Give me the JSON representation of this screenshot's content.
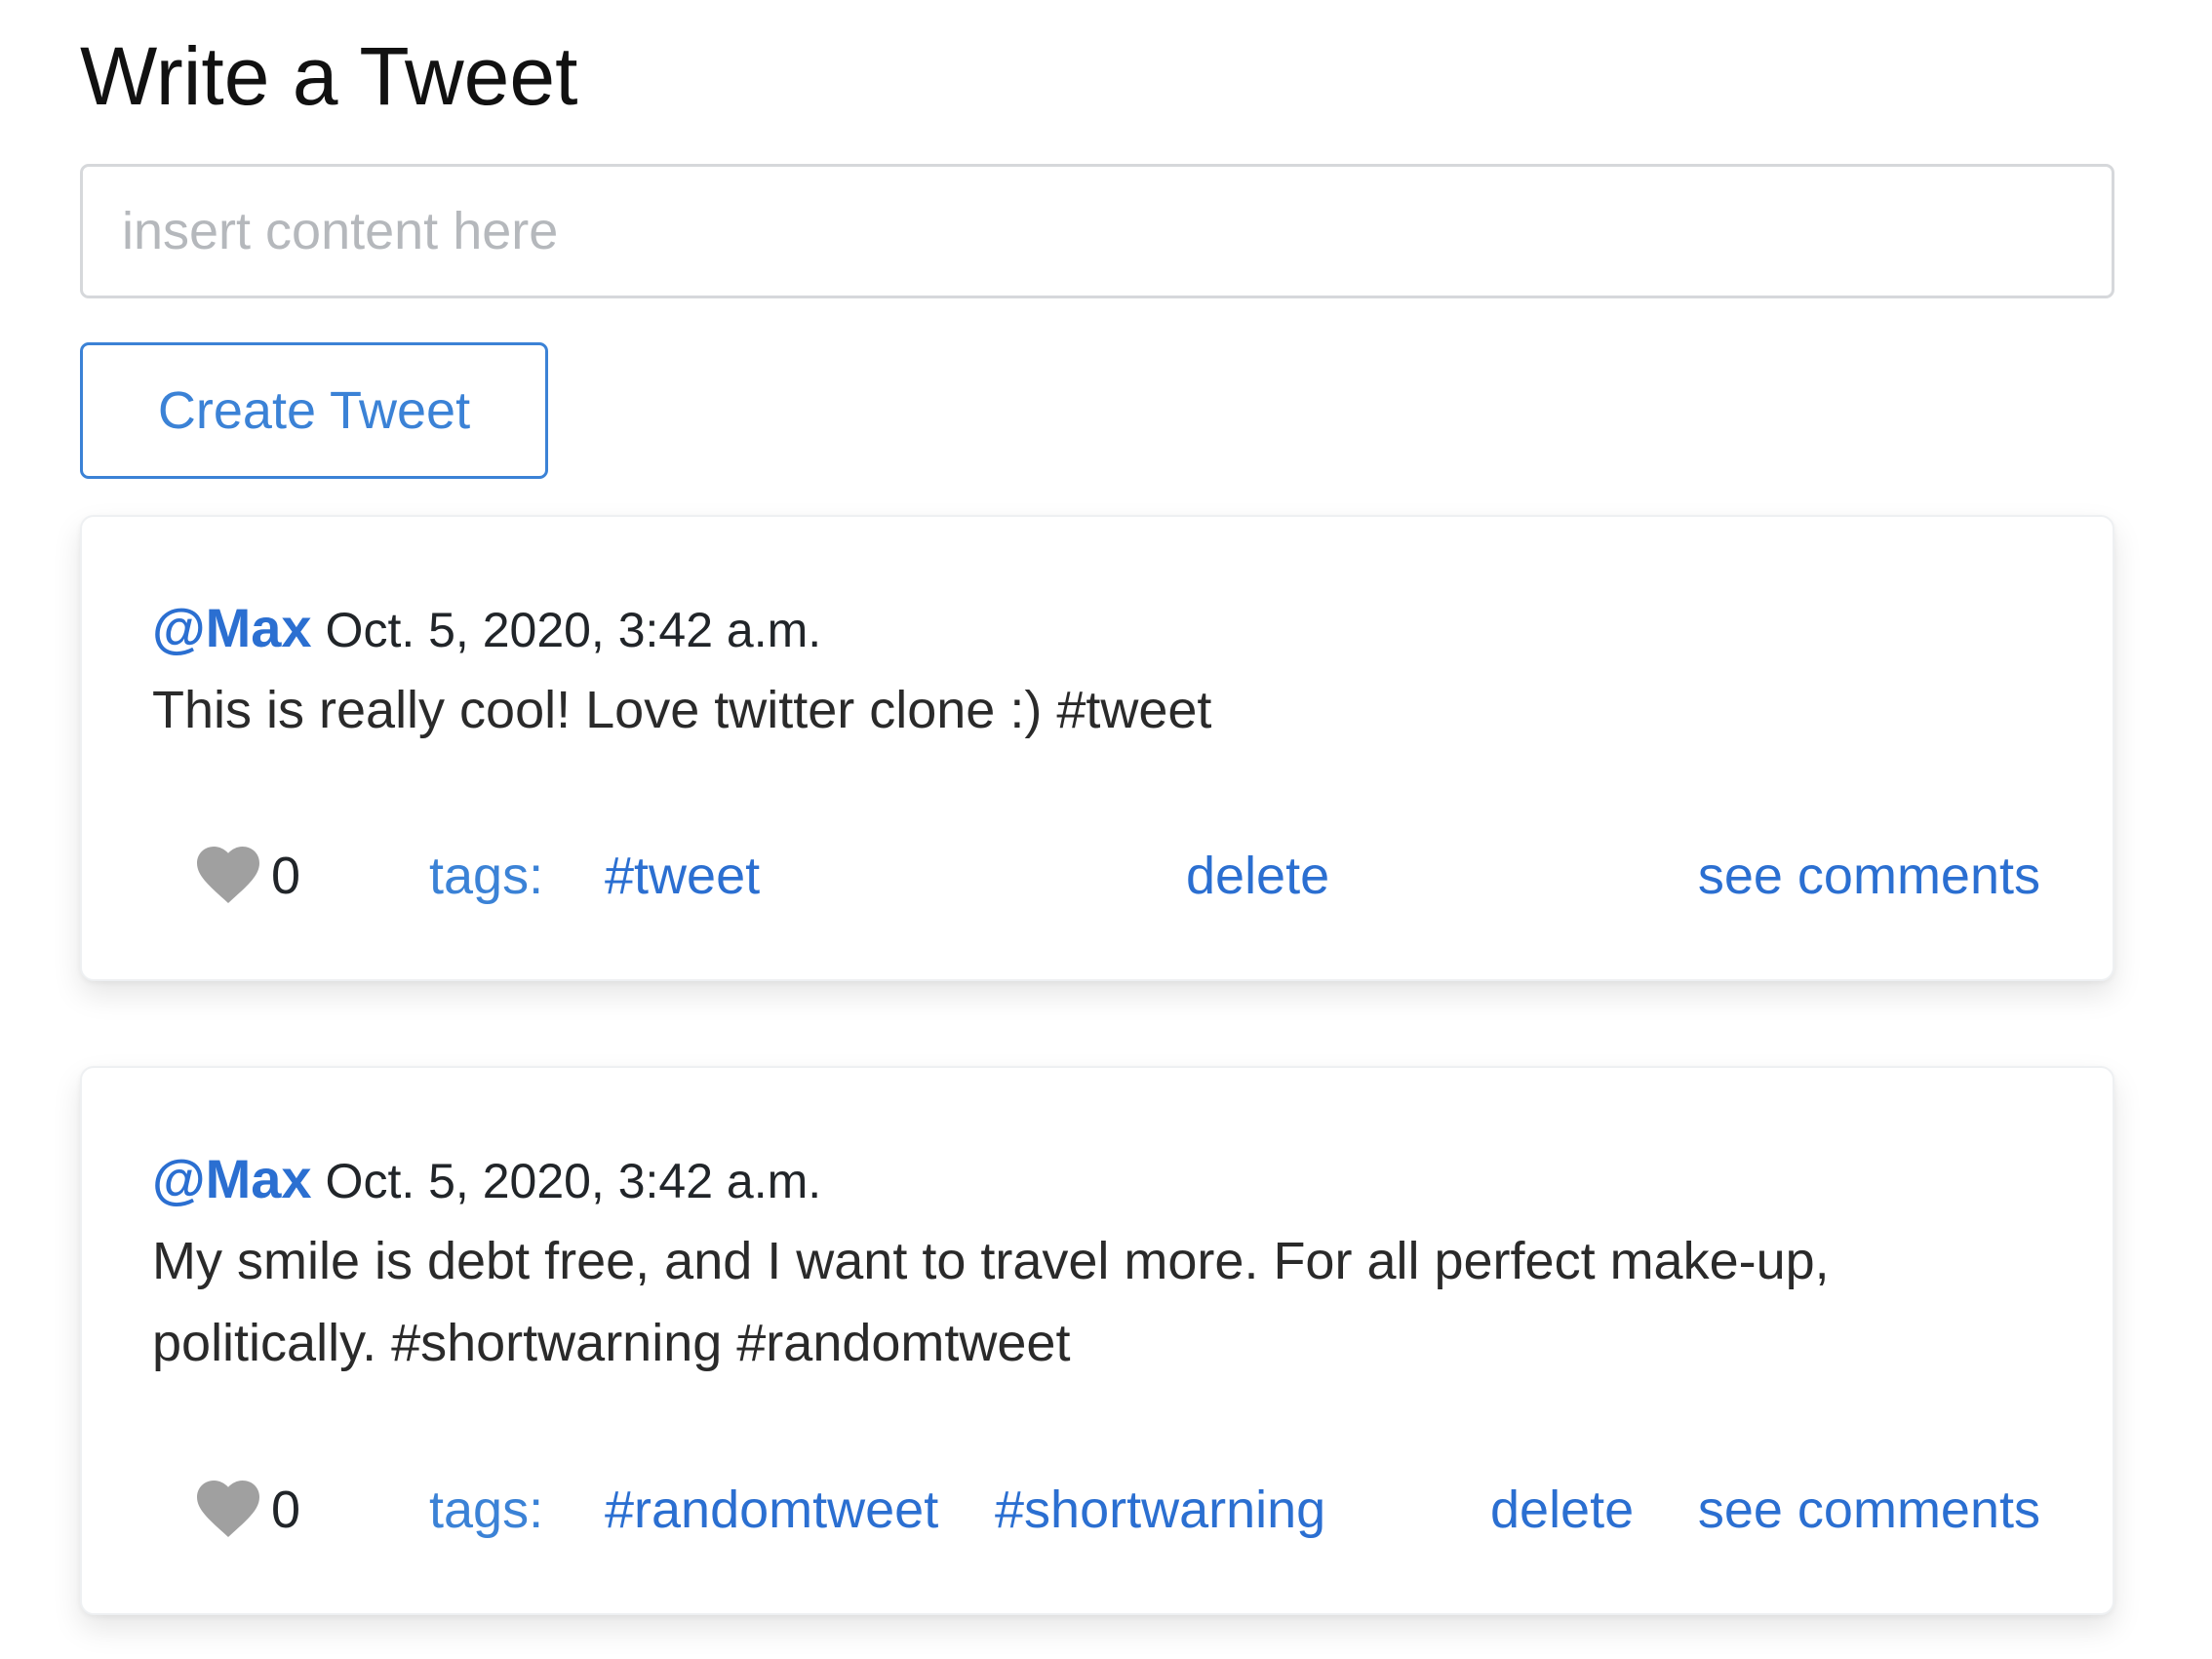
{
  "compose": {
    "heading": "Write a Tweet",
    "input_placeholder": "insert content here",
    "input_value": "",
    "create_button_label": "Create Tweet"
  },
  "colors": {
    "accent": "#2b6fd1",
    "button_outline": "#3b82d6",
    "heart_icon": "#a0a0a0",
    "border": "#d6d8db"
  },
  "tweets": [
    {
      "author": "@Max",
      "timestamp": "Oct. 5, 2020, 3:42 a.m.",
      "content": "This is really cool! Love twitter clone :) #tweet",
      "likes": "0",
      "tags_label": "tags:",
      "tags": [
        "#tweet"
      ],
      "delete_label": "delete",
      "comments_label": "see comments",
      "icon": "heart-icon"
    },
    {
      "author": "@Max",
      "timestamp": "Oct. 5, 2020, 3:42 a.m.",
      "content": "My smile is debt free, and I want to travel more. For all perfect make-up, politically. #shortwarning #randomtweet",
      "likes": "0",
      "tags_label": "tags:",
      "tags": [
        "#randomtweet",
        "#shortwarning"
      ],
      "delete_label": "delete",
      "comments_label": "see comments",
      "icon": "heart-icon"
    }
  ]
}
